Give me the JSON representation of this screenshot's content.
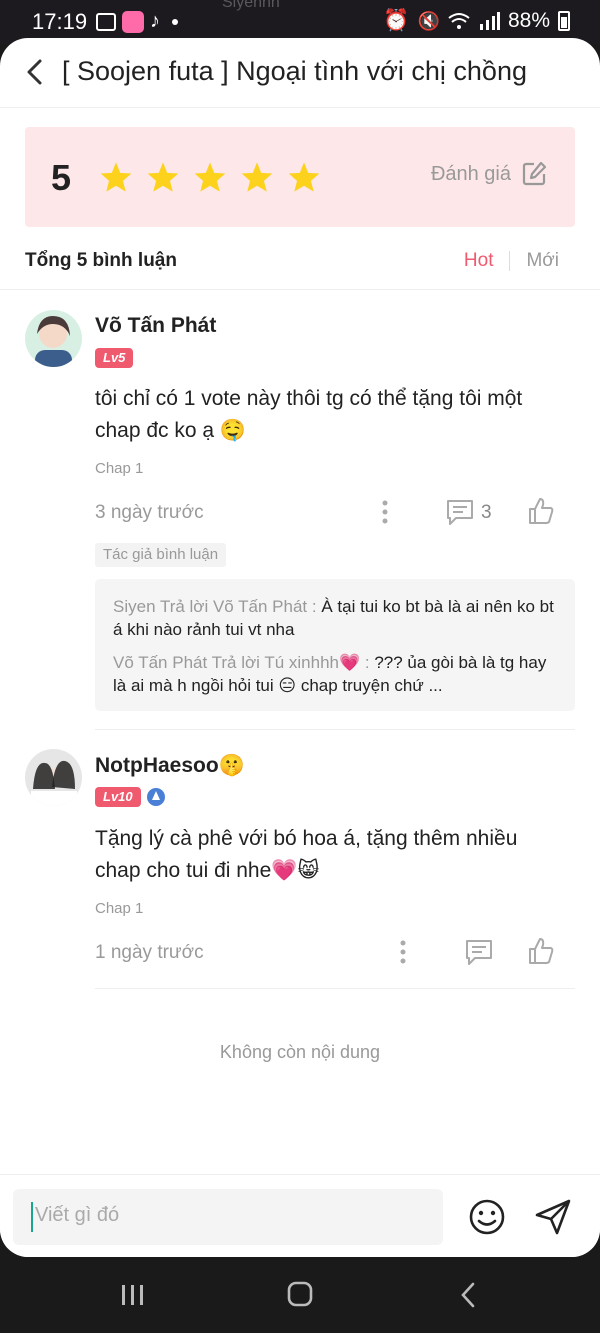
{
  "status_bar": {
    "time": "17:19",
    "battery": "88%",
    "ghost_text": "Siyenhh"
  },
  "header": {
    "title": "[ Soojen futa ] Ngoại tình với chị chồng"
  },
  "rating": {
    "score": "5",
    "stars": 5,
    "rate_label": "Đánh giá"
  },
  "comments_header": {
    "total": "Tổng 5 bình luận",
    "sort_hot": "Hot",
    "sort_new": "Mới"
  },
  "comments": [
    {
      "username": "Võ Tấn Phát",
      "level": "Lv5",
      "text": "tôi chỉ có 1 vote này thôi tg có thể tặng tôi một chap đc ko ạ 🤤",
      "chapter": "Chap 1",
      "time_ago": "3 ngày trước",
      "reply_count": "3",
      "author_tag": "Tác giả bình luận",
      "replies": [
        {
          "who": "Siyen Trả lời Võ Tấn Phát :",
          "text": " À tại tui ko bt bà là ai nên ko bt á khi nào rảnh tui vt nha"
        },
        {
          "who": "Võ Tấn Phát Trả lời Tú xinhhh💗 :",
          "text": " ??? ủa gòi bà là tg hay là ai mà h ngồi hỏi tui 😑 chap truyện chứ ..."
        }
      ]
    },
    {
      "username": "NotpHaesoo🤫",
      "level": "Lv10",
      "text": "Tặng lý cà phê với bó hoa á, tặng thêm nhiều chap cho tui đi nhe💗😸",
      "chapter": "Chap 1",
      "time_ago": "1 ngày trước"
    }
  ],
  "end_note": "Không còn nội dung",
  "input": {
    "placeholder": "Viết gì đó"
  },
  "colors": {
    "accent": "#ef5a6f",
    "rating_bg": "#fde7e9",
    "star": "#fcd21d"
  }
}
